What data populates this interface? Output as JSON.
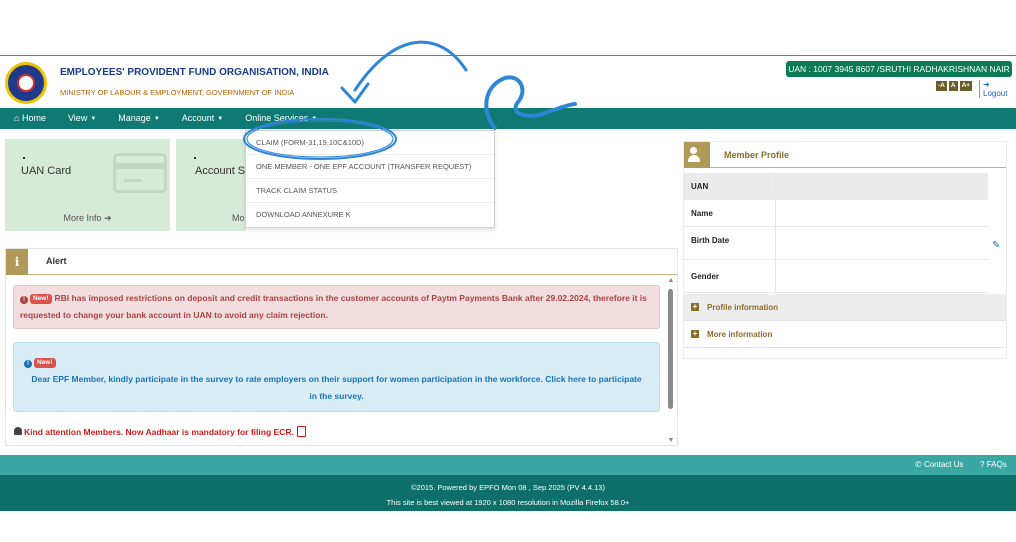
{
  "header": {
    "org_name": "EMPLOYEES' PROVIDENT FUND ORGANISATION, INDIA",
    "org_sub": "MINISTRY OF LABOUR & EMPLOYMENT, GOVERNMENT OF INDIA",
    "uan_badge": "UAN : 1007 3945 8607 /SRUTHI RADHAKRISHNAN NAIR",
    "font_sizes": [
      "-A",
      "A",
      "A+"
    ],
    "logout_label": "Logout",
    "logo_icon": "epfo-emblem-icon"
  },
  "nav": {
    "home": "Home",
    "home_icon": "home-icon",
    "view": "View",
    "manage": "Manage",
    "account": "Account",
    "online_services": "Online Services"
  },
  "dropdown": {
    "items": [
      "CLAIM (FORM-31,19,10C&10D)",
      "ONE MEMBER - ONE EPF ACCOUNT (TRANSFER REQUEST)",
      "TRACK CLAIM STATUS",
      "DOWNLOAD ANNEXURE K"
    ]
  },
  "cards": [
    {
      "title": "UAN Card",
      "more": "More Info"
    },
    {
      "title": "Account S",
      "more": "Mo"
    }
  ],
  "alert": {
    "title": "Alert",
    "badge": "New!",
    "box1_text": "RBI has imposed restrictions on deposit and credit transactions in the customer accounts of Paytm Payments Bank after 29.02.2024, therefore it is requested to change your bank account in UAN to avoid any claim rejection.",
    "box2_text": "Dear EPF Member, kindly participate in the survey to rate employers on their support for women participation in the workforce. Click here to participate in the survey.",
    "kind_attention": "Kind attention Members. Now Aadhaar is mandatory for filing ECR."
  },
  "profile": {
    "title": "Member Profile",
    "rows": [
      {
        "label": "UAN",
        "value": ""
      },
      {
        "label": "Name",
        "value": ""
      },
      {
        "label": "Birth Date",
        "value": ""
      },
      {
        "label": "Gender",
        "value": ""
      }
    ],
    "sections": [
      "Profile information",
      "More information"
    ]
  },
  "footer": {
    "contact": "Contact Us",
    "faqs": "FAQs",
    "copyright": "©2015. Powered by EPFO Mon 08 , Sep 2025 (PV 4.4.13)",
    "best_viewed": "This site is best viewed at 1920 x 1080 resolution in Mozilla Firefox 58.0+"
  },
  "colors": {
    "nav_bg": "#0f7a73",
    "uan_badge_bg": "#0b7a55",
    "panel_accent": "#b1995a",
    "alert_danger": "#a94442",
    "alert_info": "#1a73b5",
    "annotation": "#2f86d6",
    "footer_bg": "#0e6e69"
  }
}
